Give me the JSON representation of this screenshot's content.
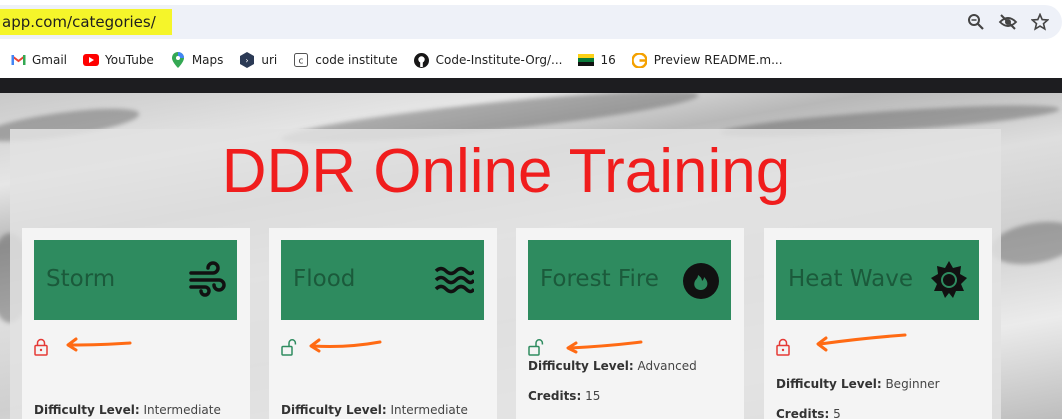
{
  "browser": {
    "url": "app.com/categories/",
    "icons": [
      "zoom-icon",
      "eye-slash-icon",
      "star-icon"
    ],
    "bookmarks": [
      {
        "label": "Gmail",
        "icon": "gmail-icon"
      },
      {
        "label": "YouTube",
        "icon": "youtube-icon"
      },
      {
        "label": "Maps",
        "icon": "maps-icon"
      },
      {
        "label": "uri",
        "icon": "uri-icon"
      },
      {
        "label": "code institute",
        "icon": "code-institute-icon"
      },
      {
        "label": "Code-Institute-Org/...",
        "icon": "github-icon"
      },
      {
        "label": "16",
        "icon": "flag-icon"
      },
      {
        "label": "Preview README.m...",
        "icon": "preview-icon"
      }
    ]
  },
  "page": {
    "title": "DDR Online Training",
    "colors": {
      "title": "#f01d1d",
      "card_head": "#2e8b5f",
      "locked": "#e53935",
      "unlocked": "#2e8b5f",
      "annotation_arrow": "#ff6a13"
    },
    "difficulty_label": "Difficulty Level:",
    "credits_label": "Credits:",
    "cards": [
      {
        "name": "Storm",
        "icon": "wind-icon",
        "lock": "locked",
        "difficulty": "Intermediate",
        "credits": ""
      },
      {
        "name": "Flood",
        "icon": "waves-icon",
        "lock": "unlocked",
        "difficulty": "Intermediate",
        "credits": ""
      },
      {
        "name": "Forest Fire",
        "icon": "fire-icon",
        "lock": "unlocked",
        "difficulty": "Advanced",
        "credits": "15"
      },
      {
        "name": "Heat Wave",
        "icon": "sun-icon",
        "lock": "locked",
        "difficulty": "Beginner",
        "credits": "5"
      }
    ]
  }
}
